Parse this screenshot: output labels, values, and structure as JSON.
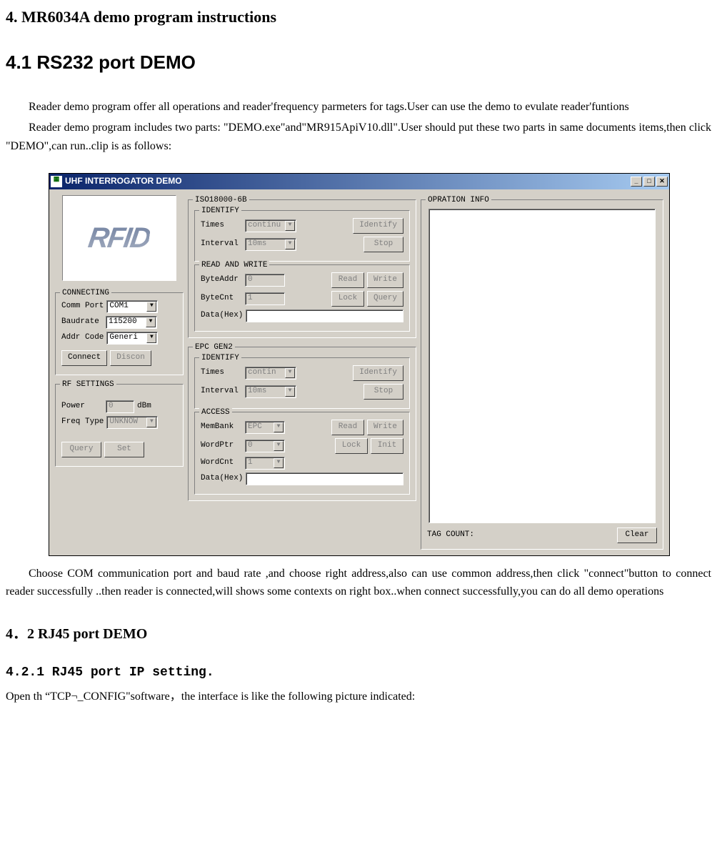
{
  "headings": {
    "h1": "4. MR6034A demo program instructions",
    "h2": "4.1 RS232   port DEMO",
    "h3": "4．2   RJ45 port DEMO",
    "h4": "4.2.1 RJ45 port IP setting."
  },
  "paragraphs": {
    "p1": "Reader demo program offer all operations and reader'frequency parmeters for tags.User can use the demo to evulate reader'funtions",
    "p2": "Reader demo program includes two parts: \"DEMO.exe\"and\"MR915ApiV10.dll\".User should put these two parts in same documents items,then click \"DEMO\",can run..clip is as follows:",
    "p3": "Choose COM communication port and baud rate ,and choose right address,also can use common address,then click \"connect\"button to connect reader successfully ..then reader is connected,will shows some contexts on right box..when connect successfully,you can do all demo operations",
    "p4": "Open th  “TCP¬_CONFIG\"software，the interface is like the following picture indicated:"
  },
  "window": {
    "title": "UHF INTERROGATOR DEMO",
    "logo": "RFID"
  },
  "connecting": {
    "group": "CONNECTING",
    "comm_port_label": "Comm Port",
    "comm_port_value": "COM1",
    "baudrate_label": "Baudrate",
    "baudrate_value": "115200",
    "addr_label": "Addr Code",
    "addr_value": "Generi",
    "connect_btn": "Connect",
    "discon_btn": "Discon"
  },
  "rf": {
    "group": "RF SETTINGS",
    "power_label": "Power",
    "power_value": "0",
    "power_unit": "dBm",
    "freq_label": "Freq Type",
    "freq_value": "UNKNOW",
    "query_btn": "Query",
    "set_btn": "Set"
  },
  "iso": {
    "group": "ISO18000-6B",
    "identify": {
      "group": "IDENTIFY",
      "times_label": "Times",
      "times_value": "continu",
      "interval_label": "Interval",
      "interval_value": "10ms",
      "identify_btn": "Identify",
      "stop_btn": "Stop"
    },
    "rw": {
      "group": "READ AND WRITE",
      "byteaddr_label": "ByteAddr",
      "byteaddr_value": "0",
      "bytecnt_label": "ByteCnt",
      "bytecnt_value": "1",
      "data_label": "Data(Hex)",
      "read_btn": "Read",
      "write_btn": "Write",
      "lock_btn": "Lock",
      "query_btn": "Query"
    }
  },
  "epc": {
    "group": "EPC GEN2",
    "identify": {
      "group": "IDENTIFY",
      "times_label": "Times",
      "times_value": "contin",
      "interval_label": "Interval",
      "interval_value": "10ms",
      "identify_btn": "Identify",
      "stop_btn": "Stop"
    },
    "access": {
      "group": "ACCESS",
      "membank_label": "MemBank",
      "membank_value": "EPC",
      "wordptr_label": "WordPtr",
      "wordptr_value": "0",
      "wordcnt_label": "WordCnt",
      "wordcnt_value": "1",
      "data_label": "Data(Hex)",
      "read_btn": "Read",
      "write_btn": "Write",
      "lock_btn": "Lock",
      "init_btn": "Init"
    }
  },
  "opration": {
    "group": "OPRATION INFO",
    "tag_count": "TAG COUNT:",
    "clear_btn": "Clear"
  }
}
